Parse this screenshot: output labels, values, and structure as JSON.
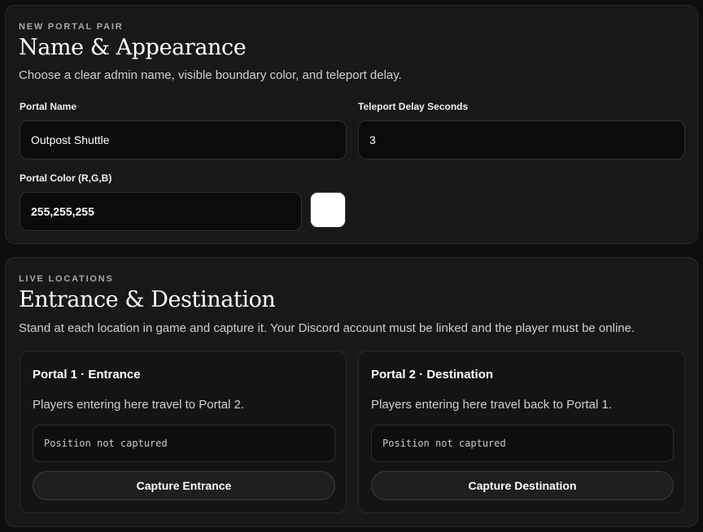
{
  "appearance": {
    "eyebrow": "NEW PORTAL PAIR",
    "title": "Name & Appearance",
    "description": "Choose a clear admin name, visible boundary color, and teleport delay.",
    "portal_name": {
      "label": "Portal Name",
      "value": "Outpost Shuttle"
    },
    "teleport_delay": {
      "label": "Teleport Delay Seconds",
      "value": "3"
    },
    "portal_color": {
      "label": "Portal Color (R,G,B)",
      "value": "255,255,255",
      "swatch_color": "#ffffff"
    }
  },
  "locations": {
    "eyebrow": "LIVE LOCATIONS",
    "title": "Entrance & Destination",
    "description": "Stand at each location in game and capture it. Your Discord account must be linked and the player must be online.",
    "portals": [
      {
        "title": "Portal 1 · Entrance",
        "description": "Players entering here travel to Portal 2.",
        "position_status": "Position not captured",
        "button_label": "Capture Entrance"
      },
      {
        "title": "Portal 2 · Destination",
        "description": "Players entering here travel back to Portal 1.",
        "position_status": "Position not captured",
        "button_label": "Capture Destination"
      }
    ]
  },
  "colors": {
    "background": "#0e0e0e",
    "card": "#181818",
    "input": "#0b0b0b",
    "text": "#ffffff",
    "muted_text": "#cfcfcf"
  }
}
